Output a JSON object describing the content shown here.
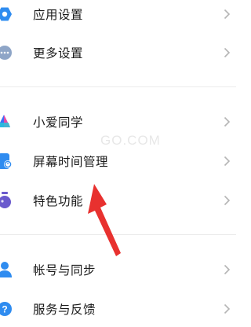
{
  "settings": {
    "items": [
      {
        "label": "应用设置",
        "icon": "gear-icon",
        "color": "#2f8cf0"
      },
      {
        "label": "更多设置",
        "icon": "more-dots-icon",
        "color": "#8ea5c7"
      },
      {
        "label": "小爱同学",
        "icon": "xiaoai-icon",
        "color": "#3b6ff5"
      },
      {
        "label": "屏幕时间管理",
        "icon": "screen-time-icon",
        "color": "#2f8cf0"
      },
      {
        "label": "特色功能",
        "icon": "flask-icon",
        "color": "#6a5acd"
      },
      {
        "label": "帐号与同步",
        "icon": "person-icon",
        "color": "#2f8cf0"
      },
      {
        "label": "服务与反馈",
        "icon": "help-icon",
        "color": "#2f8cf0"
      }
    ]
  },
  "watermark": "GO.COM",
  "annotation": {
    "color": "#e8312f"
  },
  "colors": {
    "text": "#1a1a1a",
    "chevron": "#b5b5b5",
    "divider": "#ebebeb"
  }
}
